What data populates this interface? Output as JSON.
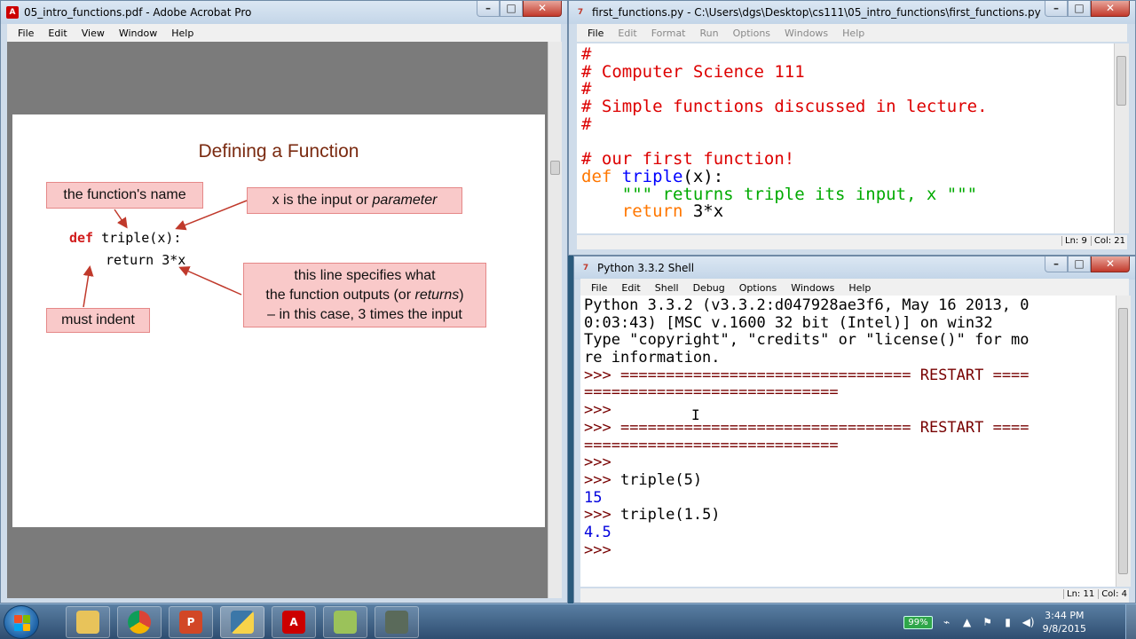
{
  "acrobat": {
    "title": "05_intro_functions.pdf - Adobe Acrobat Pro",
    "menu": [
      "File",
      "Edit",
      "View",
      "Window",
      "Help"
    ],
    "slide": {
      "title": "Defining a Function",
      "callout_name": "the function's name",
      "callout_param_prefix": "x is the input or ",
      "callout_param_em": "parameter",
      "code_def_kw": "def",
      "code_def_rest": " triple(x):",
      "code_return": "return 3*x",
      "callout_line1": "this line specifies what",
      "callout_line2_prefix": "the function outputs (or ",
      "callout_line2_em": "returns",
      "callout_line2_suffix": ")",
      "callout_line3": "– in this case, 3 times the input",
      "callout_indent": "must indent"
    }
  },
  "editor": {
    "title": "first_functions.py - C:\\Users\\dgs\\Desktop\\cs111\\05_intro_functions\\first_functions.py",
    "menu": [
      "File",
      "Edit",
      "Format",
      "Run",
      "Options",
      "Windows",
      "Help"
    ],
    "lines": {
      "l1": "#",
      "l2": "# Computer Science 111",
      "l3": "#",
      "l4": "# Simple functions discussed in lecture.",
      "l5": "#",
      "l7": "# our first function!",
      "l8_kw": "def",
      "l8_name": "triple",
      "l8_rest": "(x):",
      "l9_str": "    \"\"\" returns triple its input, x \"\"\"",
      "l10_kw": "    return",
      "l10_rest": " 3*x"
    },
    "status_ln": "Ln: 9",
    "status_col": "Col: 21"
  },
  "shell": {
    "title": "Python 3.3.2 Shell",
    "menu": [
      "File",
      "Edit",
      "Shell",
      "Debug",
      "Options",
      "Windows",
      "Help"
    ],
    "banner1": "Python 3.3.2 (v3.3.2:d047928ae3f6, May 16 2013, 0",
    "banner2": "0:03:43) [MSC v.1600 32 bit (Intel)] on win32",
    "banner3": "Type \"copyright\", \"credits\" or \"license()\" for mo",
    "banner4": "re information.",
    "prompt": ">>> ",
    "restart1": "================================ RESTART ====",
    "restart2": "============================",
    "cmd1": "triple(5)",
    "out1": "15",
    "cmd2": "triple(1.5)",
    "out2": "4.5",
    "status_ln": "Ln: 11",
    "status_col": "Col: 4"
  },
  "taskbar": {
    "apps": [
      "file-explorer",
      "chrome",
      "powerpoint",
      "python",
      "acrobat",
      "notepad",
      "tool"
    ],
    "battery": "99%",
    "time": "3:44 PM",
    "date": "9/8/2015"
  }
}
